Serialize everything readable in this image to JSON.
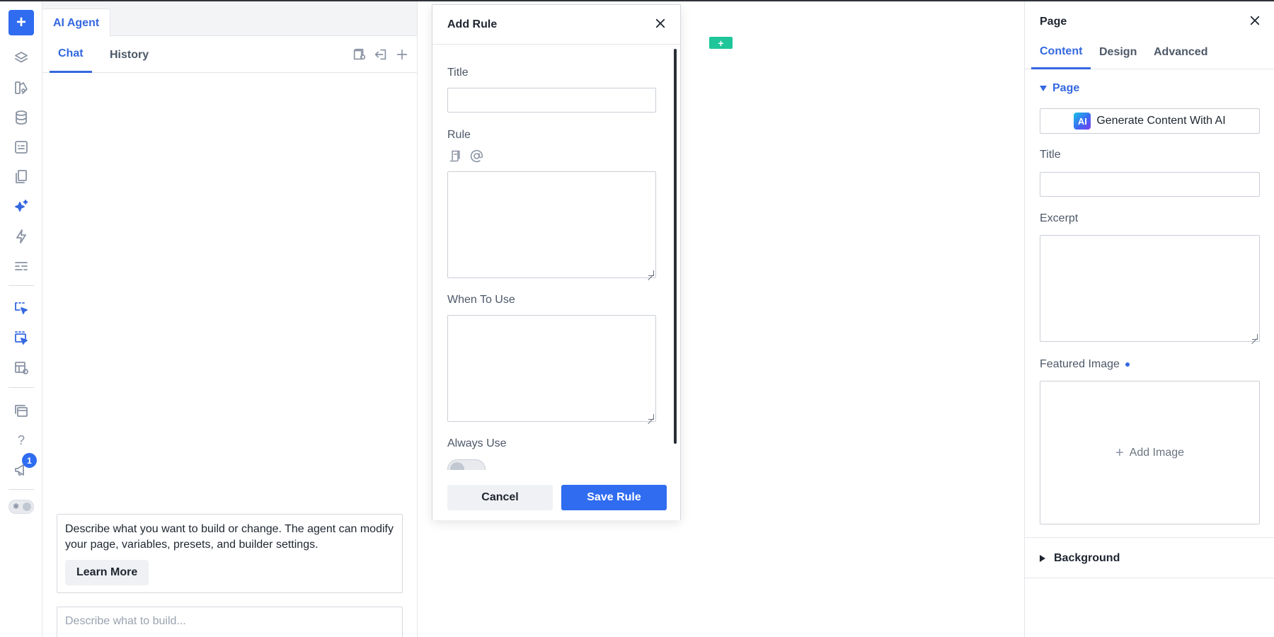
{
  "rail": {
    "add_label": "+",
    "notification_count": "1",
    "icons": [
      "layers-icon",
      "components-icon",
      "database-icon",
      "form-icon",
      "pages-icon",
      "ai-sparkle-icon",
      "lightning-icon",
      "settings-bars-icon",
      "select-cursor-icon",
      "multi-select-cursor-icon",
      "template-preview-icon",
      "windows-icon",
      "help-icon",
      "megaphone-icon",
      "theme-toggle"
    ],
    "help_label": "?"
  },
  "agent": {
    "tab_label": "AI Agent",
    "subtabs": {
      "chat": "Chat",
      "history": "History"
    },
    "info_text": "Describe what you want to build or change. The agent can modify your page, variables, presets, and builder settings.",
    "learn_more": "Learn More",
    "prompt_placeholder": "Describe what to build..."
  },
  "canvas": {
    "add_label": "+",
    "accent": "#1fc69a"
  },
  "modal": {
    "title": "Add Rule",
    "fields": {
      "title_label": "Title",
      "rule_label": "Rule",
      "when_label": "When To Use",
      "always_label": "Always Use"
    },
    "cancel": "Cancel",
    "save": "Save Rule"
  },
  "panel": {
    "title": "Page",
    "tabs": {
      "content": "Content",
      "design": "Design",
      "advanced": "Advanced"
    },
    "section": "Page",
    "generate": {
      "badge": "AI",
      "label": "Generate Content With AI"
    },
    "title_label": "Title",
    "excerpt_label": "Excerpt",
    "featured_label": "Featured Image",
    "add_image": "Add Image",
    "background": "Background"
  },
  "colors": {
    "accent": "#2f6cf0",
    "text": "#1e2530",
    "muted": "#4d5868",
    "border": "#c9ced6"
  }
}
